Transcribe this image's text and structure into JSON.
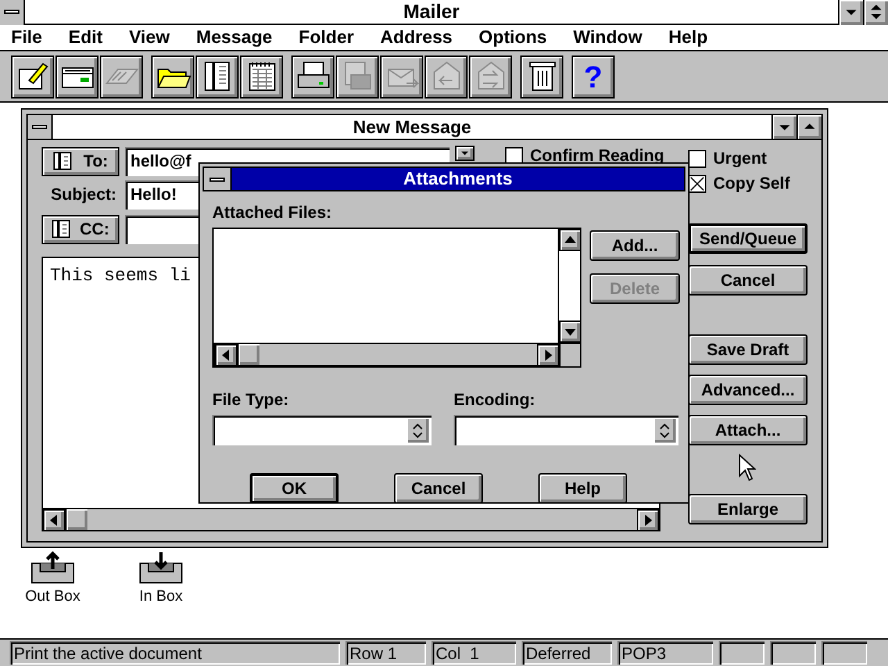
{
  "window": {
    "title": "Mailer"
  },
  "menu": [
    "File",
    "Edit",
    "View",
    "Message",
    "Folder",
    "Address",
    "Options",
    "Window",
    "Help"
  ],
  "toolbar": [
    [
      {
        "disabled": false
      },
      {
        "disabled": false
      },
      {
        "disabled": true
      }
    ],
    [
      {
        "disabled": false
      },
      {
        "disabled": false
      },
      {
        "disabled": false
      }
    ],
    [
      {
        "disabled": false
      },
      {
        "disabled": true
      },
      {
        "disabled": true
      },
      {
        "disabled": true
      },
      {
        "disabled": true
      }
    ],
    [
      {
        "disabled": false
      }
    ],
    [
      {
        "disabled": false,
        "label": "?"
      }
    ]
  ],
  "compose": {
    "title": "New Message",
    "to": {
      "button": "To:",
      "value": "hello@f"
    },
    "subject": {
      "label": "Subject:",
      "value": "Hello!"
    },
    "cc": {
      "button": "CC:"
    },
    "body": "This seems li",
    "options": [
      {
        "label": "Confirm Reading",
        "checked": false
      },
      {
        "label": "Urgent",
        "checked": false
      },
      {
        "label": "Copy Self",
        "checked": true
      }
    ],
    "buttons": [
      {
        "label": "Send/Queue",
        "default": true
      },
      {
        "label": "Cancel",
        "default": false
      },
      {
        "label": "Save Draft",
        "default": false
      },
      {
        "label": "Advanced...",
        "default": false
      },
      {
        "label": "Attach...",
        "default": false
      },
      {
        "label": "Enlarge",
        "default": false
      }
    ]
  },
  "dialog": {
    "title": "Attachments",
    "files_label": "Attached Files:",
    "side_buttons": [
      {
        "label": "Add...",
        "disabled": false
      },
      {
        "label": "Delete",
        "disabled": true
      }
    ],
    "file_type_label": "File Type:",
    "encoding_label": "Encoding:",
    "buttons": [
      {
        "label": "OK",
        "default": true
      },
      {
        "label": "Cancel",
        "default": false
      },
      {
        "label": "Help",
        "default": false
      }
    ]
  },
  "desktop_icons": [
    {
      "label": "Out Box",
      "kind": "out"
    },
    {
      "label": "In Box",
      "kind": "in"
    }
  ],
  "status_bar": [
    "Print the active document",
    "Row 1",
    "Col  1",
    "Deferred",
    "POP3"
  ]
}
